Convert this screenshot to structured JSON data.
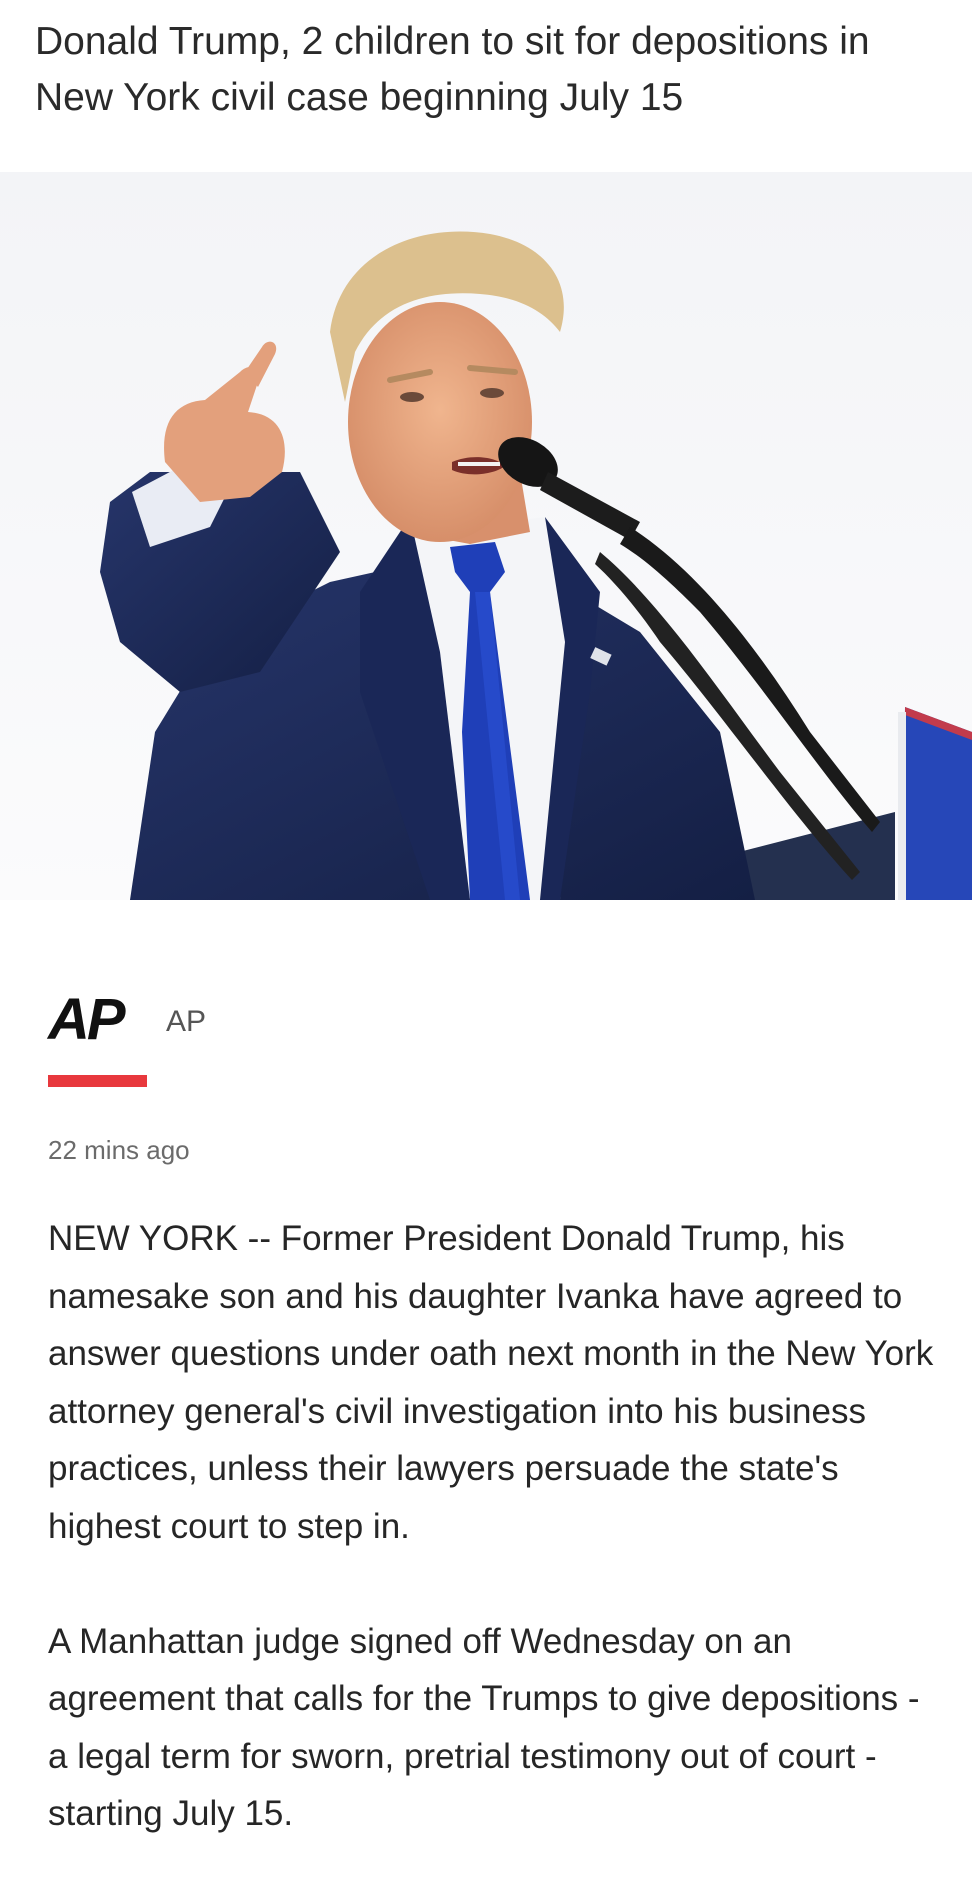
{
  "article": {
    "headline": "Donald Trump, 2 children to sit for depositions in New York civil case beginning July 15",
    "hero_image": {
      "alt": "Donald Trump pointing while speaking at a microphone"
    },
    "source": {
      "logo_text": "AP",
      "name": "AP",
      "brand_color": "#e8383d"
    },
    "timestamp": "22 mins ago",
    "paragraphs": [
      "NEW YORK -- Former President Donald Trump, his namesake son and his daughter Ivanka have agreed to answer questions under oath next month in the New York attorney general's civil investigation into his business practices, unless their lawyers persuade the state's highest court to step in.",
      "A Manhattan judge signed off Wednesday on an agreement that calls for the Trumps to give depositions - a legal term for sworn, pretrial testimony out of court - starting July 15."
    ]
  },
  "colors": {
    "background": "#ffffff",
    "headline": "#2a2a2a",
    "body_text": "#262626",
    "meta_text": "#6b6b6b",
    "suit": "#1f2d5c",
    "tie": "#1f3fb8"
  }
}
